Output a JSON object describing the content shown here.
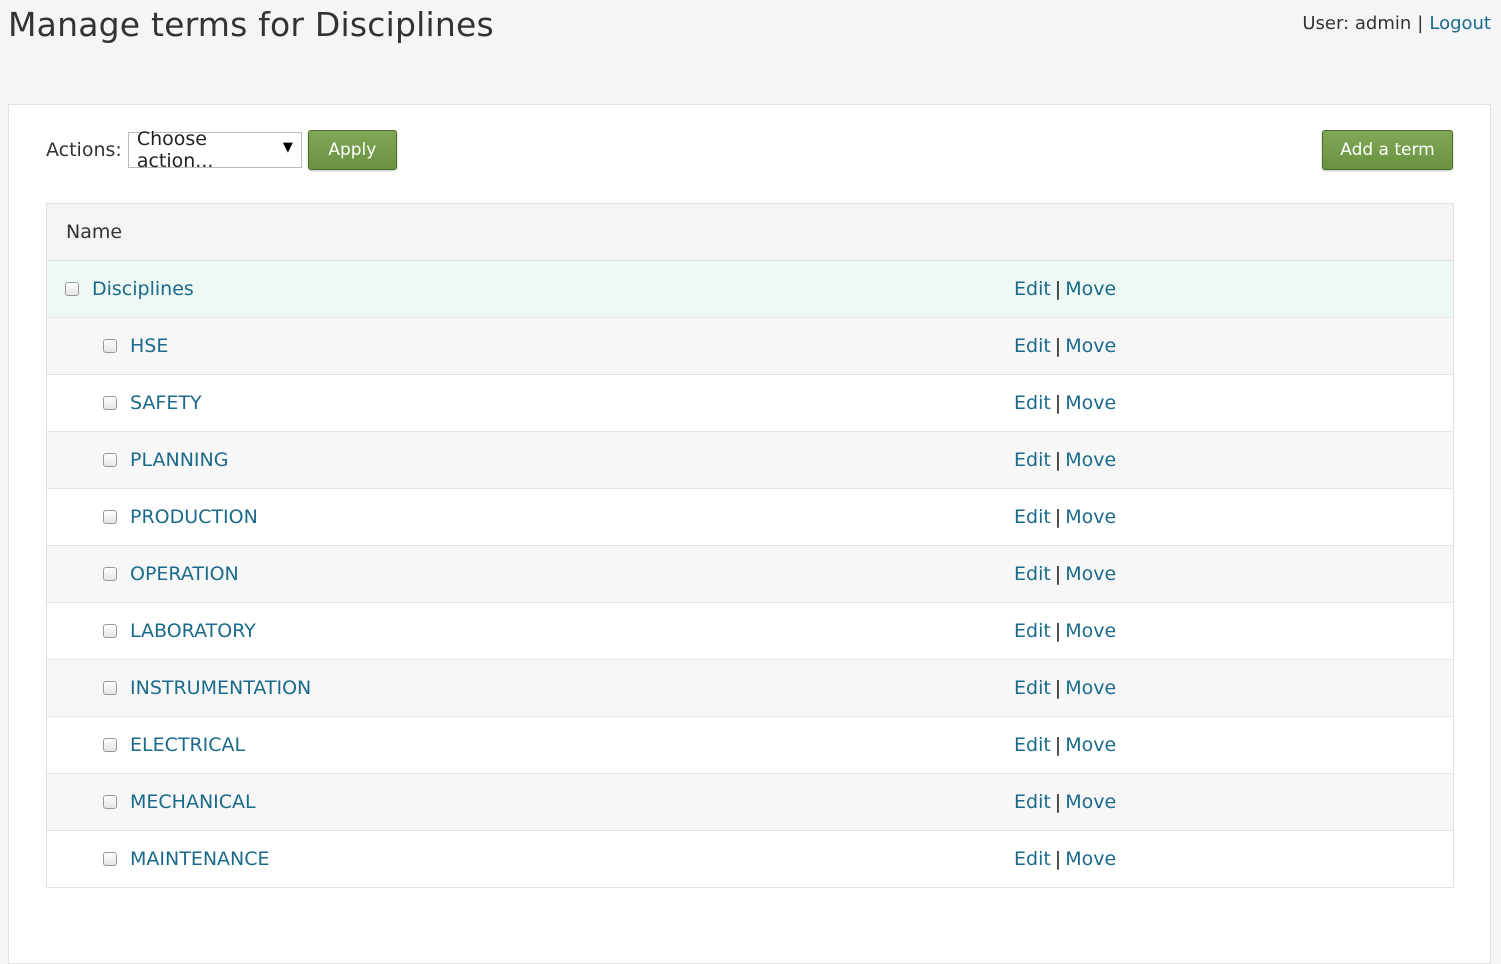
{
  "page": {
    "title": "Manage terms for Disciplines"
  },
  "user_bar": {
    "prefix": "User:",
    "username": "admin",
    "separator": "|",
    "logout": "Logout"
  },
  "toolbar": {
    "actions_label": "Actions:",
    "select_value": "Choose action...",
    "apply_label": "Apply",
    "add_term_label": "Add a term",
    "button_color": "#76a04b"
  },
  "table": {
    "header_name": "Name",
    "edit_label": "Edit",
    "move_label": "Move",
    "ops_separator": "|",
    "link_color": "#1a6a8b",
    "rows": [
      {
        "name": "Disciplines",
        "depth": 0
      },
      {
        "name": "HSE",
        "depth": 1
      },
      {
        "name": "SAFETY",
        "depth": 1
      },
      {
        "name": "PLANNING",
        "depth": 1
      },
      {
        "name": "PRODUCTION",
        "depth": 1
      },
      {
        "name": "OPERATION",
        "depth": 1
      },
      {
        "name": "LABORATORY",
        "depth": 1
      },
      {
        "name": "INSTRUMENTATION",
        "depth": 1
      },
      {
        "name": "ELECTRICAL",
        "depth": 1
      },
      {
        "name": "MECHANICAL",
        "depth": 1
      },
      {
        "name": "MAINTENANCE",
        "depth": 1
      }
    ]
  }
}
